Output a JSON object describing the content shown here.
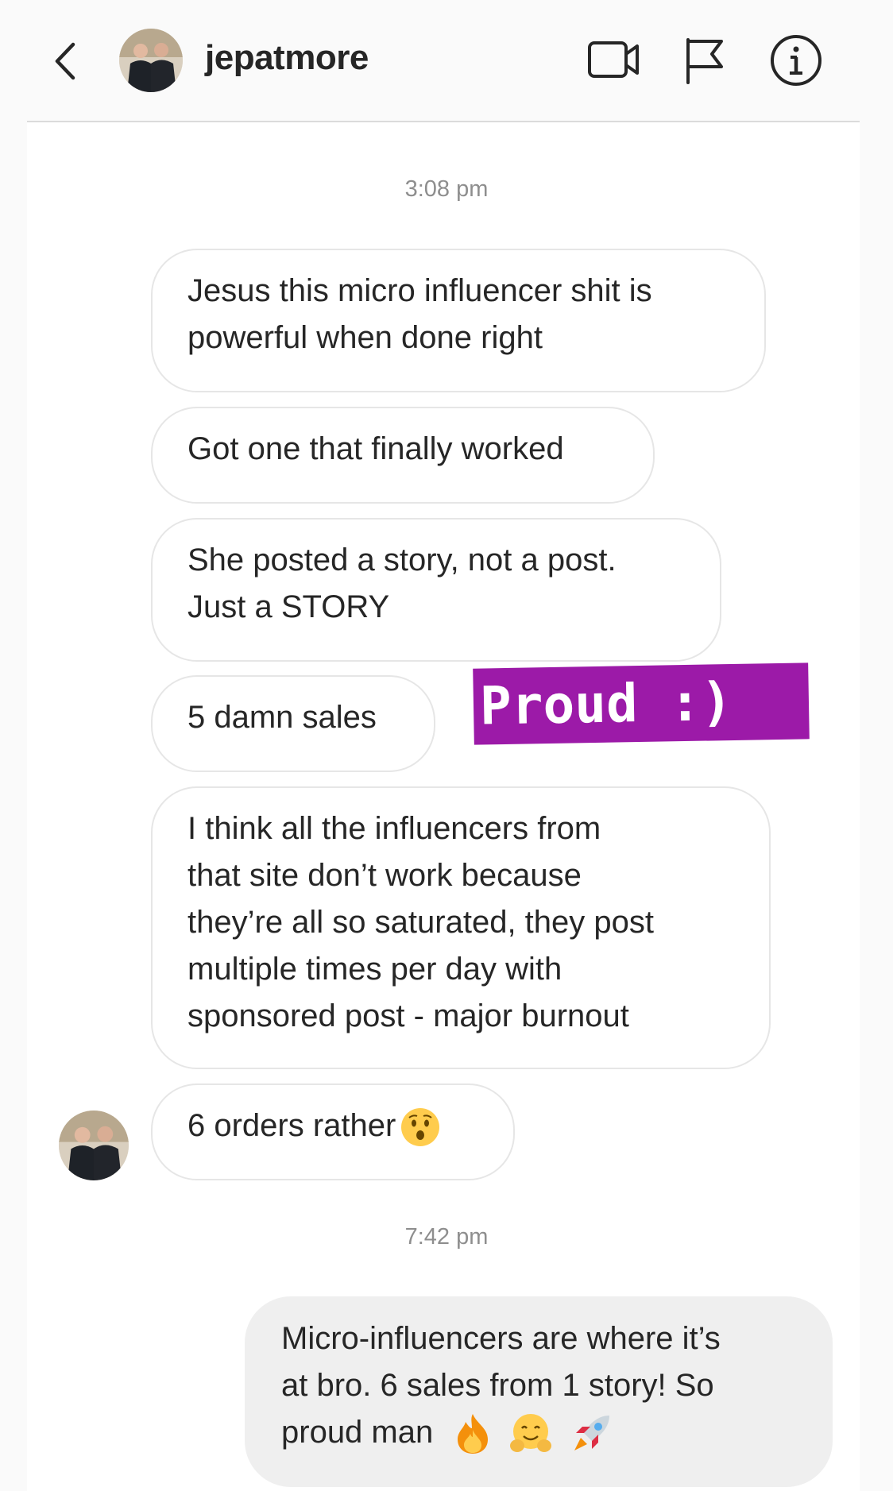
{
  "header": {
    "username": "jepatmore",
    "icons": [
      "back-icon",
      "video-call-icon",
      "report-flag-icon",
      "info-icon"
    ]
  },
  "thread": {
    "timestamp_1": "3:08 pm",
    "timestamp_2": "7:42 pm",
    "received": [
      {
        "lines": [
          "Jesus this micro influencer shit is",
          "powerful when done right"
        ]
      },
      {
        "lines": [
          "Got one that finally worked"
        ]
      },
      {
        "lines": [
          "She posted a story, not a post.",
          "Just a STORY"
        ]
      },
      {
        "lines": [
          "5 damn sales"
        ]
      },
      {
        "lines": [
          "I think all the influencers from",
          "that site don’t work because",
          "they’re all so saturated, they post",
          "multiple times per day with",
          "sponsored post - major burnout"
        ]
      },
      {
        "lines": [
          "6 orders rather"
        ],
        "emoji": "hushed-face-emoji"
      }
    ],
    "sent": [
      {
        "lines": [
          "Micro-influencers are where it’s",
          "at bro. 6 sales from 1 story! So",
          "proud man"
        ],
        "emoji": [
          "fire-emoji",
          "hugging-face-emoji",
          "rocket-emoji"
        ]
      }
    ]
  },
  "sticker": {
    "text": "Proud :)",
    "color": "#9c1aa8"
  }
}
